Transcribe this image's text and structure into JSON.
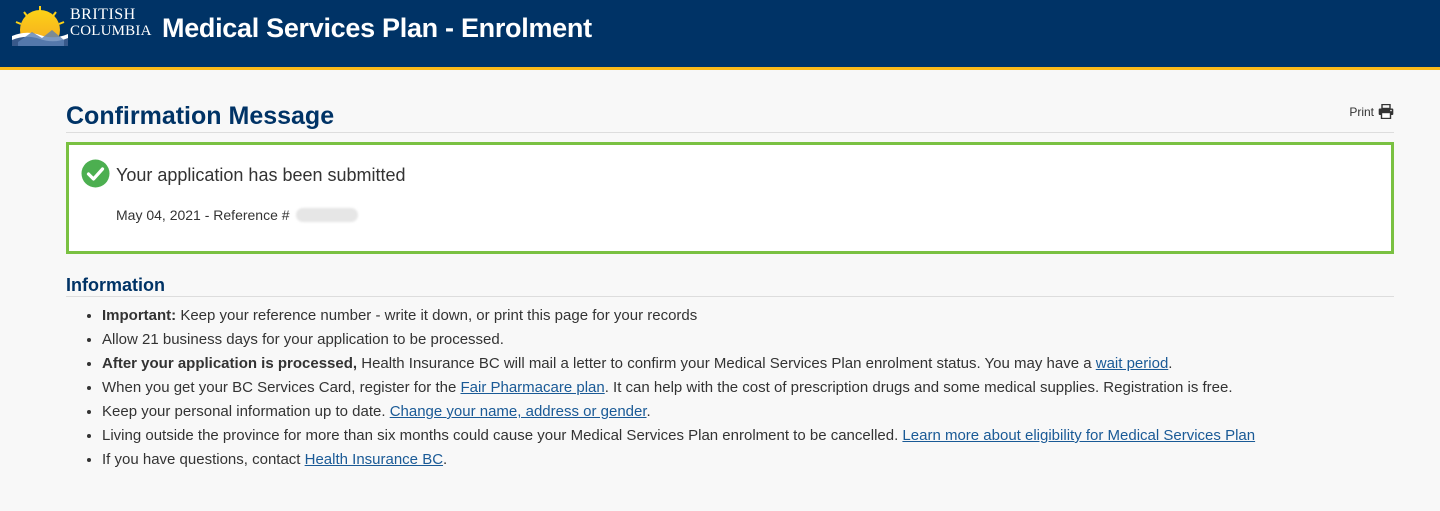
{
  "header": {
    "logo_line1": "BRITISH",
    "logo_line2": "COLUMBIA",
    "title": "Medical Services Plan - Enrolment",
    "colors": {
      "background": "#003366",
      "accent": "#fcba19"
    }
  },
  "page": {
    "title": "Confirmation Message",
    "print_label": "Print",
    "print_icon": "printer-icon"
  },
  "confirmation": {
    "icon": "check-circle-icon",
    "message": "Your application has been submitted",
    "date": "May 04, 2021",
    "reference_label": "- Reference #",
    "border_color": "#7ac142"
  },
  "info": {
    "title": "Information",
    "items": [
      {
        "bold": "Important:",
        "text": " Keep your reference number - write it down, or print this page for your records"
      },
      {
        "text": "Allow 21 business days for your application to be processed."
      },
      {
        "bold": "After your application is processed,",
        "text": " Health Insurance BC will mail a letter to confirm your Medical Services Plan enrolment status. You may have a ",
        "link": "wait period",
        "after": "."
      },
      {
        "text": "When you get your BC Services Card, register for the ",
        "link": "Fair Pharmacare plan",
        "after": ". It can help with the cost of prescription drugs and some medical supplies. Registration is free."
      },
      {
        "text": "Keep your personal information up to date. ",
        "link": "Change your name, address or gender",
        "after": "."
      },
      {
        "text": "Living outside the province for more than six months could cause your Medical Services Plan enrolment to be cancelled. ",
        "link": "Learn more about eligibility for Medical Services Plan",
        "after": ""
      },
      {
        "text": "If you have questions, contact ",
        "link": "Health Insurance BC",
        "after": "."
      }
    ],
    "link_color": "#1a5a96"
  }
}
